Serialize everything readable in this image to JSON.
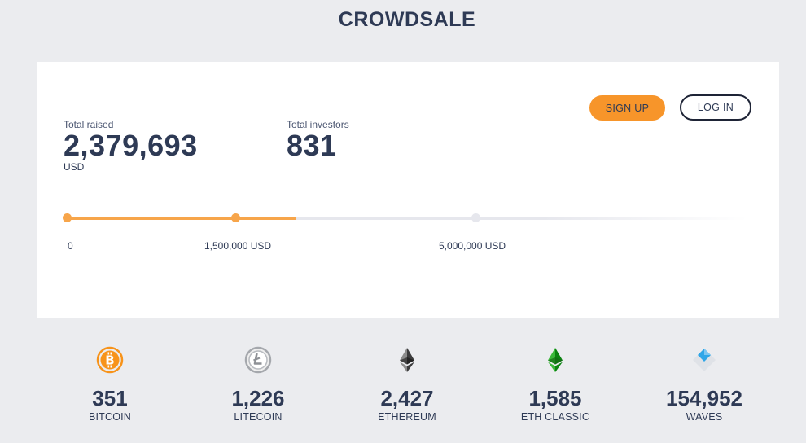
{
  "header": {
    "title": "CROWDSALE"
  },
  "stats": {
    "total_raised": {
      "label": "Total raised",
      "value": "2,379,693",
      "unit": "USD"
    },
    "total_investors": {
      "label": "Total investors",
      "value": "831"
    }
  },
  "actions": {
    "signup_label": "SIGN UP",
    "login_label": "LOG IN"
  },
  "progress": {
    "raised_usd": 2379693,
    "ticks": {
      "start": "0",
      "mid": "1,500,000 USD",
      "goal": "5,000,000 USD"
    }
  },
  "currencies": [
    {
      "icon": "bitcoin-icon",
      "amount": "351",
      "name": "BITCOIN"
    },
    {
      "icon": "litecoin-icon",
      "amount": "1,226",
      "name": "LITECOIN"
    },
    {
      "icon": "ethereum-icon",
      "amount": "2,427",
      "name": "ETHEREUM"
    },
    {
      "icon": "eth-classic-icon",
      "amount": "1,585",
      "name": "ETH CLASSIC"
    },
    {
      "icon": "waves-icon",
      "amount": "154,952",
      "name": "WAVES"
    }
  ],
  "colors": {
    "accent": "#f7952a",
    "progress_fill": "#f7a54a",
    "text": "#2e3a55",
    "background": "#ebecef",
    "card": "#ffffff"
  }
}
